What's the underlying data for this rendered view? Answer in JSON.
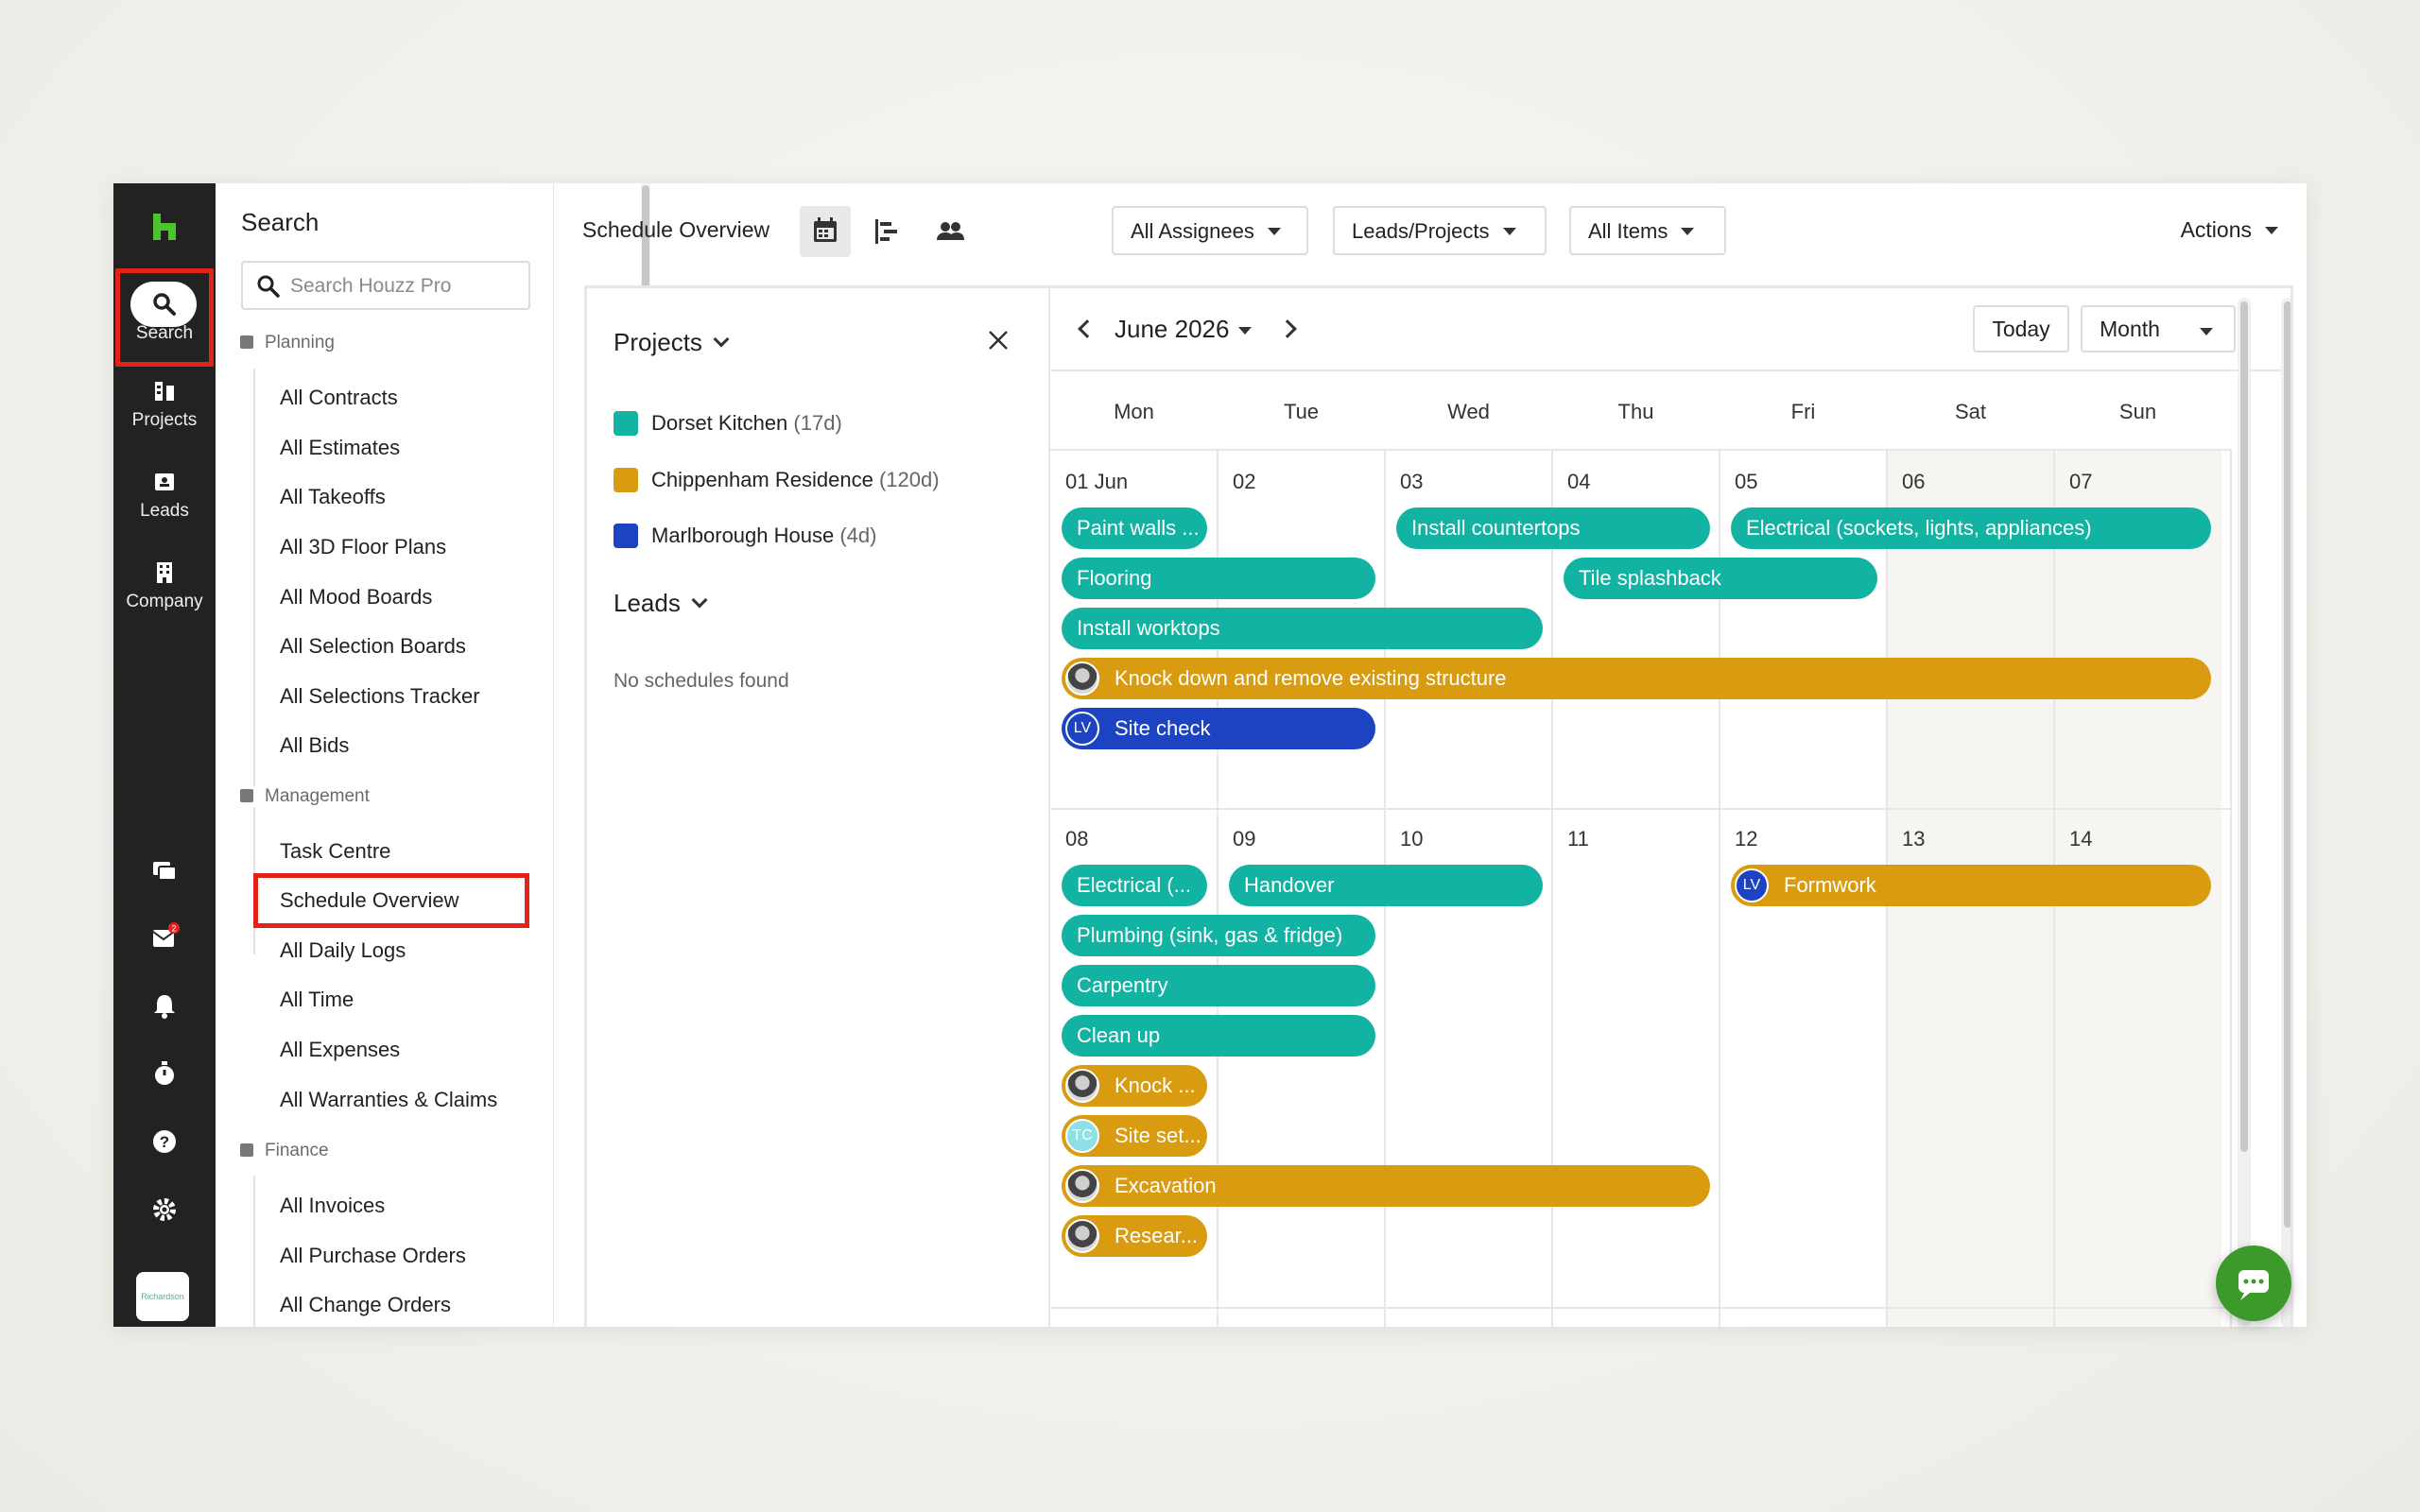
{
  "rail": {
    "items": [
      {
        "label": "Search",
        "icon": "search-icon"
      },
      {
        "label": "Projects",
        "icon": "projects-icon"
      },
      {
        "label": "Leads",
        "icon": "leads-icon"
      },
      {
        "label": "Company",
        "icon": "company-icon"
      }
    ],
    "notification_badge": "2",
    "avatar_text": "Richardson"
  },
  "sidebar": {
    "title": "Search",
    "search_placeholder": "Search Houzz Pro",
    "sections": [
      {
        "heading": "Planning",
        "items": [
          "All Contracts",
          "All Estimates",
          "All Takeoffs",
          "All 3D Floor Plans",
          "All Mood Boards",
          "All Selection Boards",
          "All Selections Tracker",
          "All Bids"
        ]
      },
      {
        "heading": "Management",
        "items": [
          "Task Centre",
          "Schedule Overview",
          "All Daily Logs",
          "All Time",
          "All Expenses",
          "All Warranties & Claims"
        ]
      },
      {
        "heading": "Finance",
        "items": [
          "All Invoices",
          "All Purchase Orders",
          "All Change Orders"
        ]
      }
    ]
  },
  "toolbar": {
    "title": "Schedule Overview",
    "assignees": "All Assignees",
    "leads_projects": "Leads/Projects",
    "items": "All Items",
    "actions": "Actions"
  },
  "projects_panel": {
    "heading": "Projects",
    "projects": [
      {
        "name": "Dorset Kitchen",
        "duration": "(17d)",
        "color": "#13b3a3"
      },
      {
        "name": "Chippenham Residence",
        "duration": "(120d)",
        "color": "#d99c10"
      },
      {
        "name": "Marlborough House",
        "duration": "(4d)",
        "color": "#1b43c2"
      }
    ],
    "leads_heading": "Leads",
    "leads_empty": "No schedules found"
  },
  "calendar": {
    "month": "June 2026",
    "today": "Today",
    "view": "Month",
    "days_of_week": [
      "Mon",
      "Tue",
      "Wed",
      "Thu",
      "Fri",
      "Sat",
      "Sun"
    ],
    "week1": [
      "01 Jun",
      "02",
      "03",
      "04",
      "05",
      "06",
      "07"
    ],
    "week2": [
      "08",
      "09",
      "10",
      "11",
      "12",
      "13",
      "14"
    ],
    "events": {
      "paint_walls": "Paint walls ...",
      "install_countertops": "Install countertops",
      "electrical_full": "Electrical (sockets, lights, appliances)",
      "flooring": "Flooring",
      "tile_splashback": "Tile splashback",
      "install_worktops": "Install worktops",
      "knock_down": "Knock down and remove existing structure",
      "site_check": "Site check",
      "electrical_short": "Electrical (...",
      "handover": "Handover",
      "formwork": "Formwork",
      "plumbing": "Plumbing (sink, gas & fridge)",
      "carpentry": "Carpentry",
      "clean_up": "Clean up",
      "knock_short": "Knock ...",
      "site_set": "Site set...",
      "excavation": "Excavation",
      "research": "Resear..."
    },
    "avatar_lv": "LV",
    "avatar_tc": "TC"
  }
}
